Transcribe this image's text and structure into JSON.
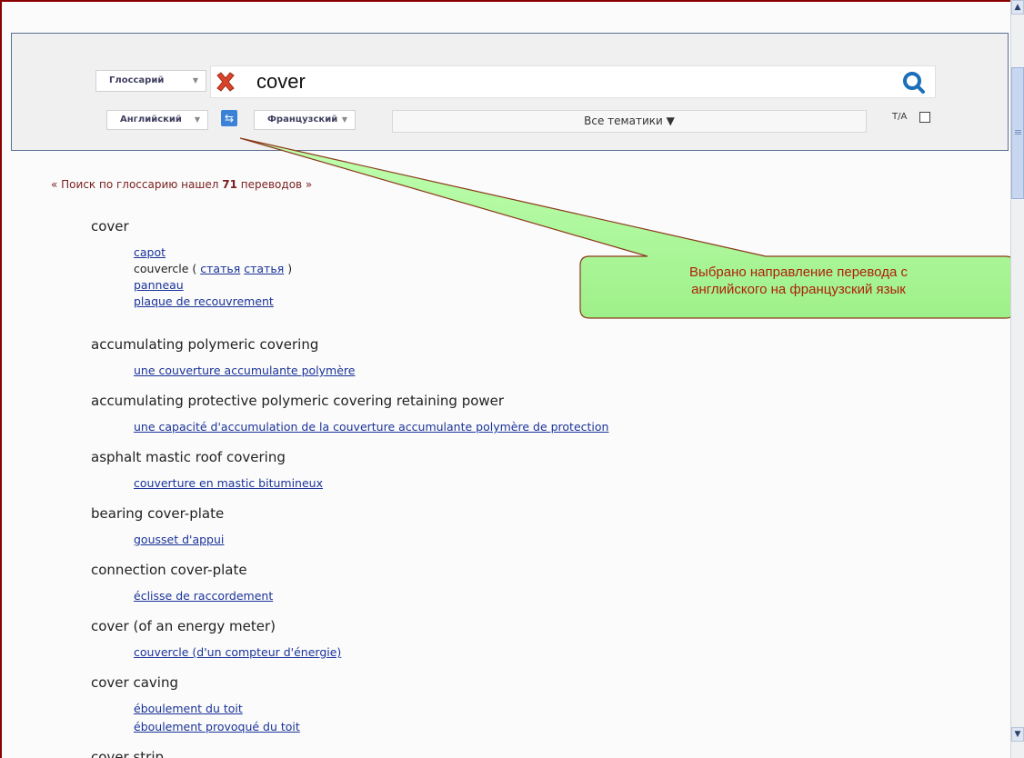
{
  "search": {
    "mode_dropdown": "Глоссарий",
    "query": "cover",
    "source_language": "Английский",
    "target_language": "Французский",
    "themes": "Все тематики ▼",
    "translit_label": "Т/А"
  },
  "results": {
    "summary_prefix": "« Поиск по глоссарию нашел ",
    "count": "71",
    "summary_suffix": " переводов »",
    "entries": [
      {
        "term": "cover",
        "translations": [
          "capot",
          "couvercle",
          "panneau",
          "plaque de recouvrement"
        ],
        "article_links": [
          "статья",
          "статья"
        ]
      },
      {
        "term": "accumulating polymeric covering",
        "translations": [
          "une couverture accumulante polymère"
        ]
      },
      {
        "term": "accumulating protective polymeric covering retaining power",
        "translations": [
          "une capacité d'accumulation de la couverture accumulante polymère de protection"
        ]
      },
      {
        "term": "asphalt mastic roof covering",
        "translations": [
          "couverture en mastic bitumineux"
        ]
      },
      {
        "term": "bearing cover-plate",
        "translations": [
          "gousset d'appui"
        ]
      },
      {
        "term": "connection cover-plate",
        "translations": [
          "éclisse de raccordement"
        ]
      },
      {
        "term": "cover (of an energy meter)",
        "translations": [
          "couvercle (d'un compteur d'énergie)"
        ]
      },
      {
        "term": "cover caving",
        "translations": [
          "éboulement du toit",
          "éboulement provoqué du toit"
        ]
      },
      {
        "term": "cover strip",
        "translations": []
      }
    ]
  },
  "callout": {
    "line1": "Выбрано направление перевода с",
    "line2": "английского на французский язык"
  },
  "colors": {
    "callout_fill": "#aaff99",
    "callout_border": "#8b3a1a",
    "link": "#1a3399",
    "frame_border": "#8b0000"
  }
}
